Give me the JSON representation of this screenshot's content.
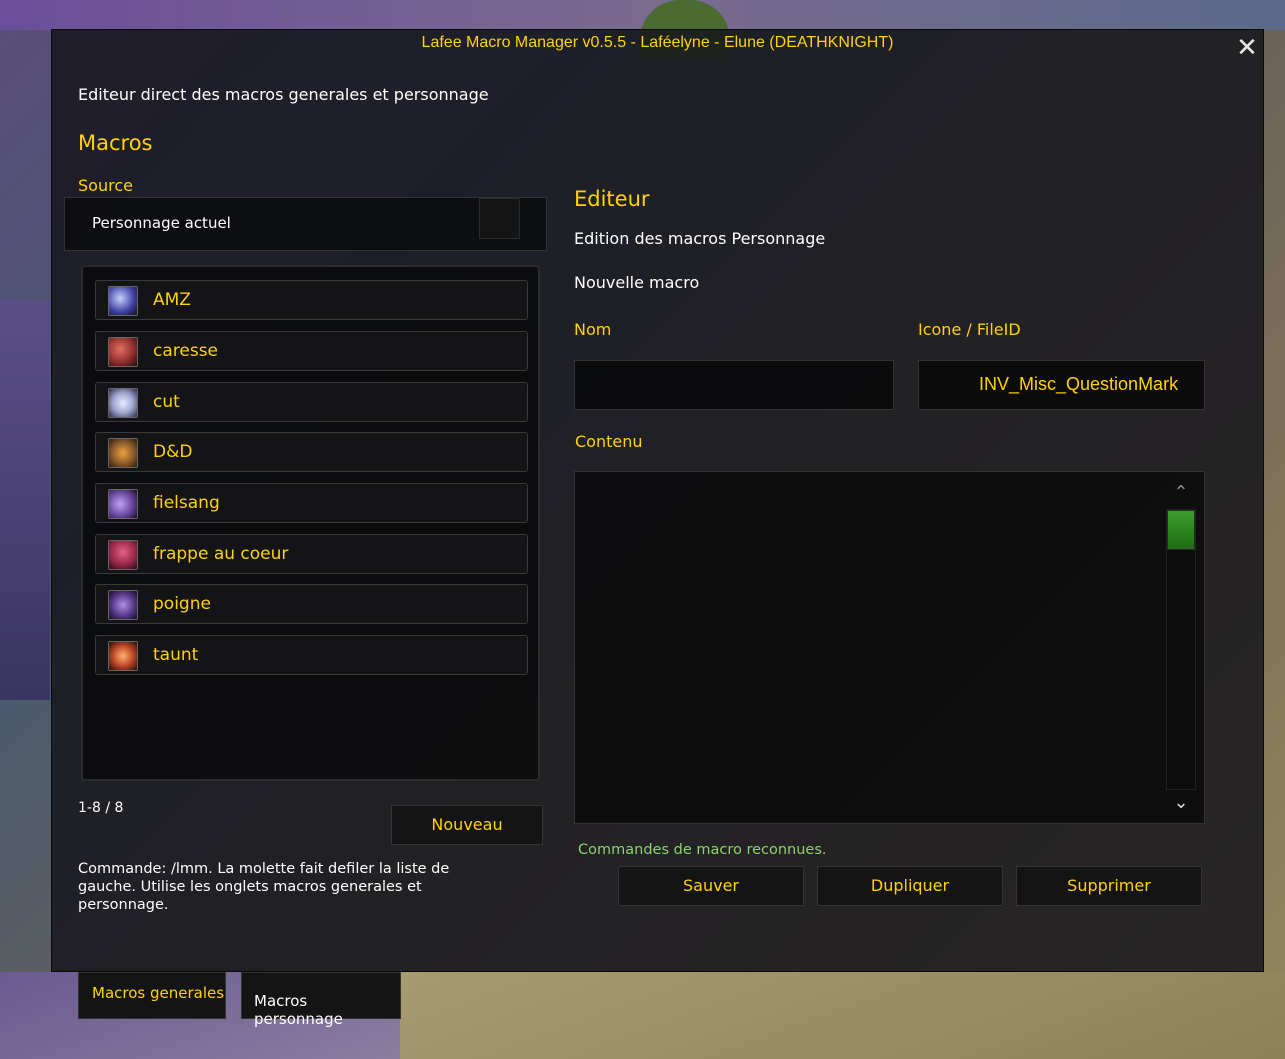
{
  "window": {
    "title": "Lafee Macro Manager v0.5.5 - Laféelyne - Elune (DEATHKNIGHT)",
    "close_label": "✕"
  },
  "left": {
    "subtitle": "Editeur direct des macros generales et personnage",
    "macros_heading": "Macros",
    "source_label": "Source",
    "source_value": "Personnage actuel",
    "items": [
      {
        "label": "AMZ",
        "icon": "lightning-rune-icon",
        "color": "#3a3fa0"
      },
      {
        "label": "caresse",
        "icon": "blood-claw-icon",
        "color": "#8a2a2a"
      },
      {
        "label": "cut",
        "icon": "frost-sphere-icon",
        "color": "#a0a8d0"
      },
      {
        "label": "D&D",
        "icon": "death-and-decay-icon",
        "color": "#8a5a2a"
      },
      {
        "label": "fielsang",
        "icon": "shadow-strike-icon",
        "color": "#6a4aa0"
      },
      {
        "label": "frappe au coeur",
        "icon": "heart-strike-icon",
        "color": "#9a2a4a"
      },
      {
        "label": "poigne",
        "icon": "grip-icon",
        "color": "#5a3a8a"
      },
      {
        "label": "taunt",
        "icon": "dark-command-icon",
        "color": "#c04a2a"
      }
    ],
    "count": "1-8 / 8",
    "new_button": "Nouveau",
    "help": "Commande: /lmm. La molette fait defiler la liste de gauche. Utilise les onglets macros generales et personnage."
  },
  "editor": {
    "heading": "Editeur",
    "subtitle": "Edition des macros Personnage",
    "state": "Nouvelle macro",
    "name_label": "Nom",
    "name_value": "",
    "icon_label": "Icone / FileID",
    "icon_value": "INV_Misc_QuestionMark",
    "content_label": "Contenu",
    "content_value": "",
    "status": "Commandes de macro reconnues.",
    "save": "Sauver",
    "duplicate": "Dupliquer",
    "delete": "Supprimer"
  },
  "tabs": [
    {
      "label": "Macros generales"
    },
    {
      "label": "Macros personnage"
    }
  ],
  "colors": {
    "accent": "#ffd200",
    "status_ok": "#8cd26e"
  }
}
